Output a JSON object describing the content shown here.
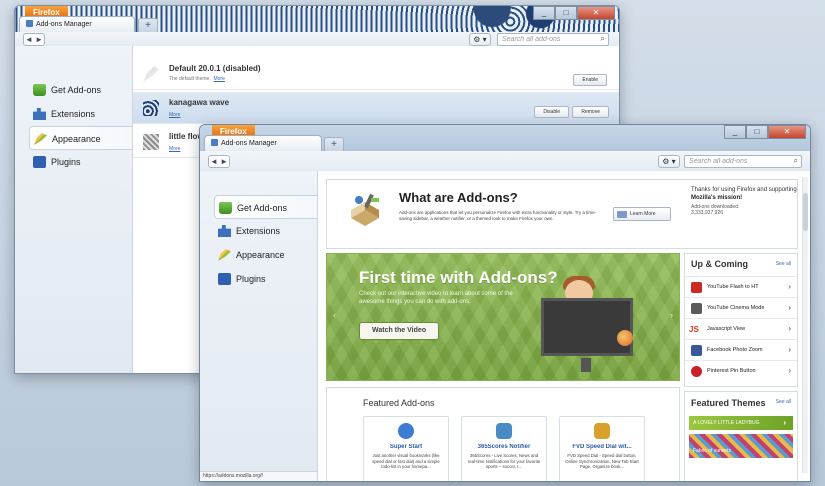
{
  "back_window": {
    "firefox_button": "Firefox",
    "tab_title": "Add-ons Manager",
    "new_tab": "+",
    "search_placeholder": "Search all add-ons",
    "nav": "◄ ►",
    "gear": "⚙ ▾",
    "categories": [
      "Get Add-ons",
      "Extensions",
      "Appearance",
      "Plugins"
    ],
    "selected_category": "Appearance",
    "themes": [
      {
        "name": "Default  20.0.1  (disabled)",
        "sub": "The default theme.",
        "more": "More",
        "buttons": [
          "Enable"
        ]
      },
      {
        "name": "kanagawa wave",
        "sub": "",
        "more": "More",
        "buttons": [
          "Disable",
          "Remove"
        ]
      },
      {
        "name": "little flow",
        "sub": "",
        "more": "More",
        "buttons": []
      }
    ]
  },
  "front_window": {
    "firefox_button": "Firefox",
    "tab_title": "Add-ons Manager",
    "new_tab": "+",
    "search_placeholder": "Search all add-ons",
    "nav": "◄ ►",
    "gear": "⚙ ▾",
    "categories": [
      "Get Add-ons",
      "Extensions",
      "Appearance",
      "Plugins"
    ],
    "selected_category": "Get Add-ons",
    "what_are": {
      "title": "What are Add-ons?",
      "description": "Add-ons are applications that let you personalize Firefox with extra functionality or style. Try a time-saving sidebar, a weather notifier, or a themed look to make Firefox your own.",
      "learn_more": "Learn More"
    },
    "thanks": {
      "line1": "Thanks for using Firefox and supporting ",
      "mozilla": "Mozilla's mission!",
      "downloads_label": "Add-ons downloaded:",
      "downloads_count": "3,333,937,926"
    },
    "banner": {
      "title": "First time with Add-ons?",
      "text": "Check out our interactive video to learn about some of the awesome things you can do with add-ons.",
      "button": "Watch the Video"
    },
    "up_coming": {
      "title": "Up & Coming",
      "see_all": "See all",
      "items": [
        {
          "label": "YouTube Flash to HT",
          "color": "#cc2a21"
        },
        {
          "label": "YouTube Cinema Mode",
          "color": "#5a5a5a"
        },
        {
          "label": "Javascript View",
          "color": "#d23a1f",
          "glyph": "JS"
        },
        {
          "label": "Facebook Photo Zoom",
          "color": "#3b5998"
        },
        {
          "label": "Pinterest Pin Button",
          "color": "#cb2027"
        }
      ]
    },
    "featured": {
      "title": "Featured Add-ons",
      "cards": [
        {
          "name": "Super Start",
          "desc": "Just another visual bookmarks (like speed dial or fast dial) and a simple todo-list in your homepa...",
          "color": "#3c7cd2"
        },
        {
          "name": "365Scores Notifier",
          "desc": "365Scores - Live Scores, News and real-time Notifications for your favorite sports – soccer, t...",
          "color": "#4a8bc4"
        },
        {
          "name": "FVD Speed Dial wit...",
          "desc": "FVD Speed Dial - Speed dial button. Online Synchronization, New Tab Start Page, Organize book...",
          "color": "#d9a12c"
        }
      ]
    },
    "featured_themes": {
      "title": "Featured Themes",
      "see_all": "See all",
      "theme1": "A LOVELY LITTLE LADYBUG",
      "theme2": "Fabric of sunsets"
    },
    "status_url": "https://addons.mozilla.org/f"
  }
}
